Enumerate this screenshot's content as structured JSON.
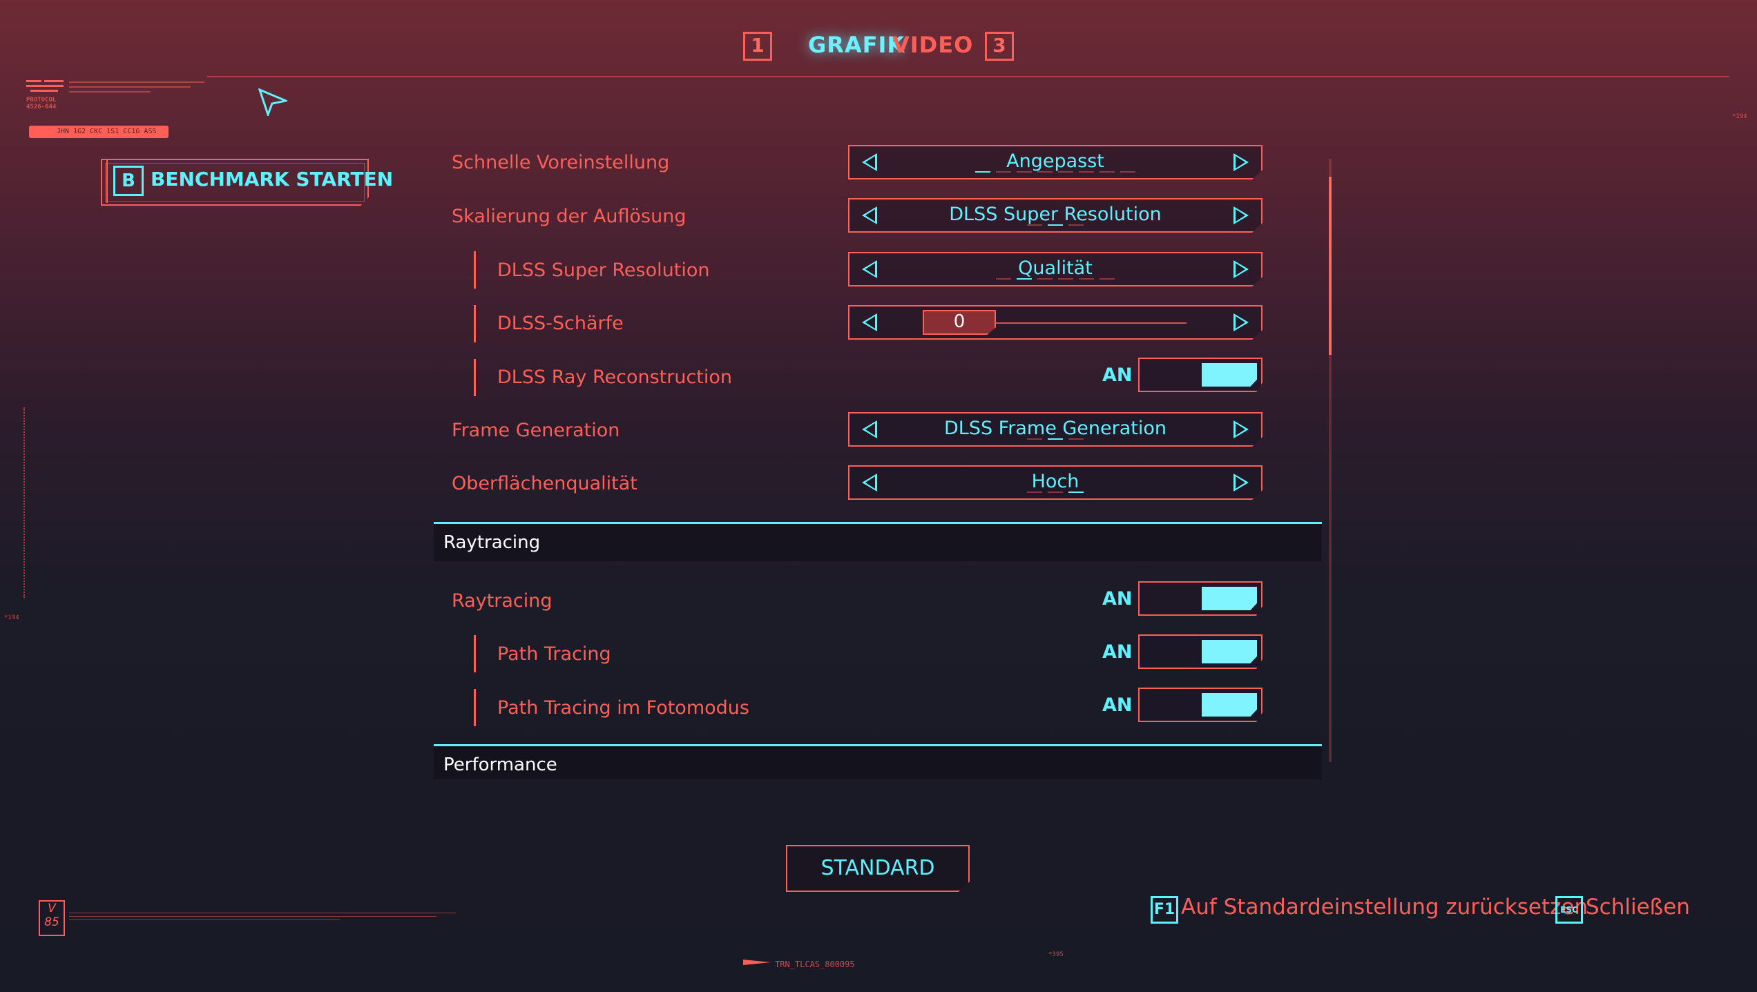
{
  "tabs": {
    "left_key": "1",
    "active": "GRAFIK",
    "inactive": "VIDEO",
    "right_key": "3"
  },
  "decor": {
    "protocol": "PROTOCOL\n4526-644",
    "pill_text": "JHN 1G2 CKC 1S1 CC1G ASS",
    "right_code_top": "*194",
    "left_code_mid": "*194",
    "bottom_code": "TRN_TLCAS_800095",
    "bottom_code2": "*395",
    "vbox": "V\n85"
  },
  "benchmark": {
    "key": "B",
    "label": "BENCHMARK STARTEN"
  },
  "settings": {
    "quick_preset": {
      "label": "Schnelle Voreinstellung",
      "value": "Angepasst"
    },
    "resolution_scaling": {
      "label": "Skalierung der Auflösung",
      "value": "DLSS Super Resolution"
    },
    "dlss_sr": {
      "label": "DLSS Super Resolution",
      "value": "Qualität"
    },
    "dlss_sharpness": {
      "label": "DLSS-Schärfe",
      "value": "0"
    },
    "dlss_rr": {
      "label": "DLSS Ray Reconstruction",
      "state": "AN"
    },
    "frame_generation": {
      "label": "Frame Generation",
      "value": "DLSS Frame Generation"
    },
    "surface_quality": {
      "label": "Oberflächenqualität",
      "value": "Hoch"
    }
  },
  "raytracing_section": {
    "title": "Raytracing",
    "raytracing": {
      "label": "Raytracing",
      "state": "AN"
    },
    "path_tracing": {
      "label": "Path Tracing",
      "state": "AN"
    },
    "path_tracing_photo": {
      "label": "Path Tracing im Fotomodus",
      "state": "AN"
    }
  },
  "performance_section": {
    "title": "Performance"
  },
  "buttons": {
    "standard": "STANDARD"
  },
  "footer": {
    "reset_key": "F1",
    "reset_label": "Auf Standardeinstellung zurücksetzen",
    "close_key": "ESC",
    "close_label": "Schließen"
  },
  "colors": {
    "accent_cyan": "#5ef2ff",
    "accent_red": "#ff5f57"
  }
}
